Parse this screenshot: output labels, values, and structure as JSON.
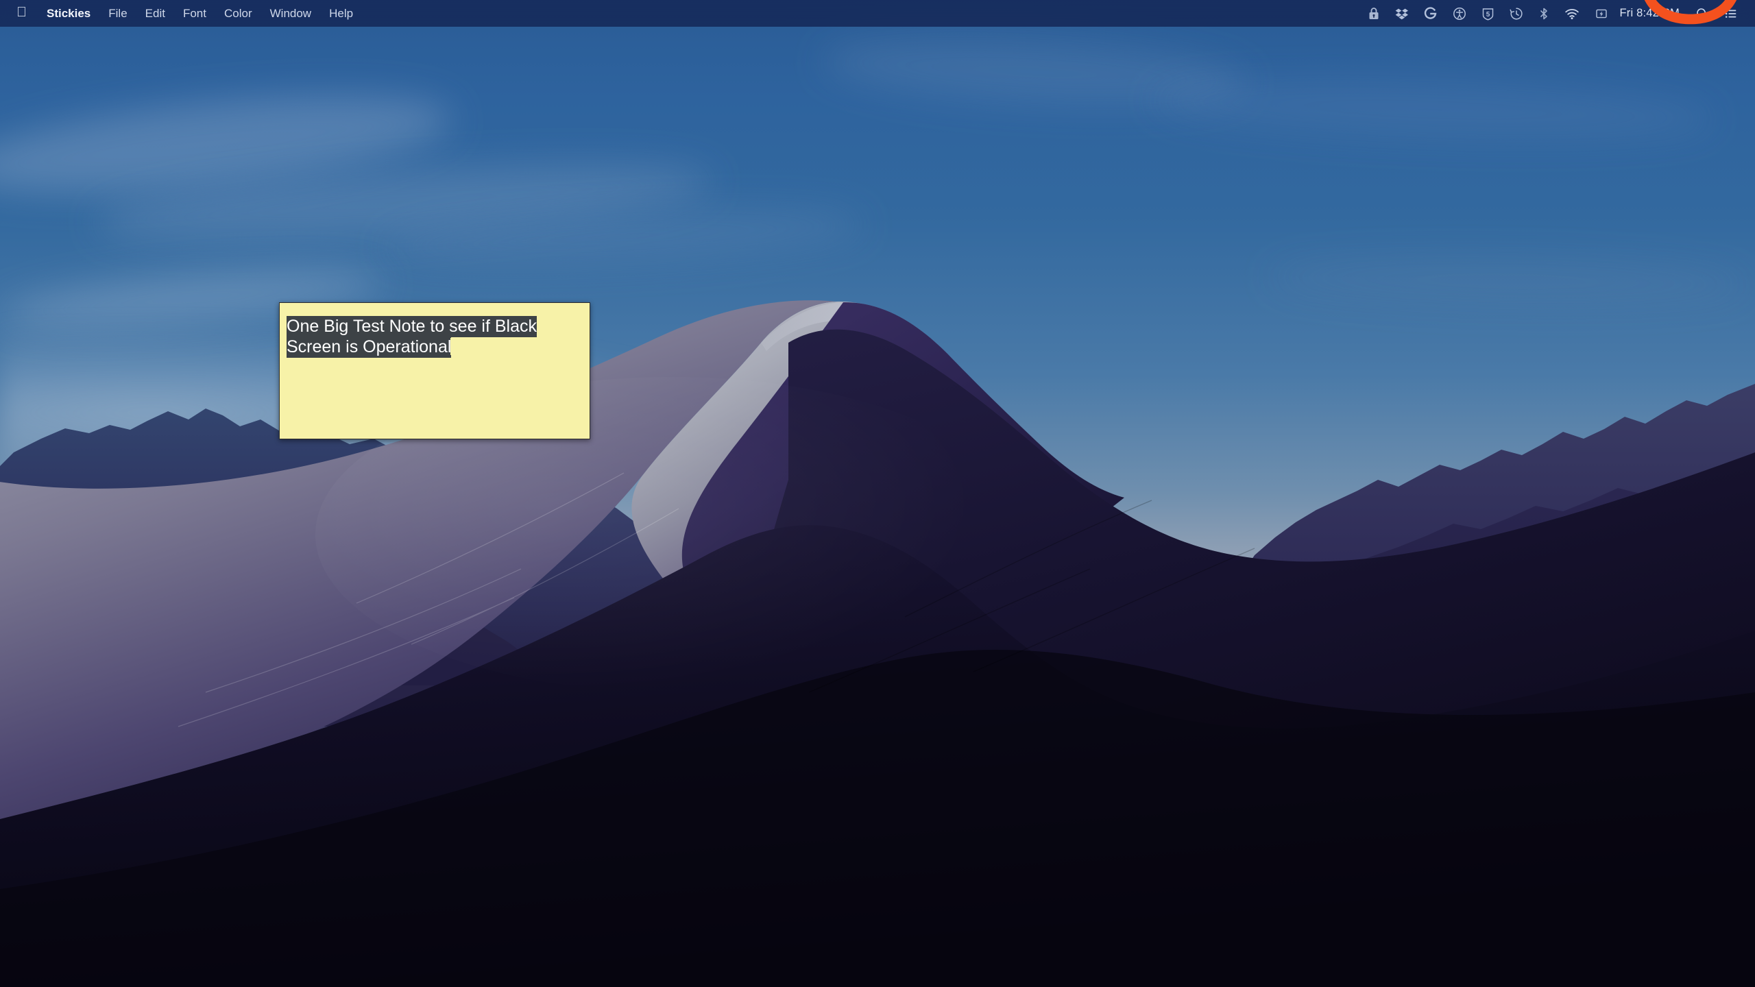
{
  "menubar": {
    "apple_logo": "apple-logo",
    "app_name": "Stickies",
    "menus": [
      {
        "label": "File"
      },
      {
        "label": "Edit"
      },
      {
        "label": "Font"
      },
      {
        "label": "Color"
      },
      {
        "label": "Window"
      },
      {
        "label": "Help"
      }
    ],
    "status_icons": [
      {
        "name": "lock-icon",
        "title": "Lock"
      },
      {
        "name": "dropbox-icon",
        "title": "Dropbox"
      },
      {
        "name": "logitech-g-icon",
        "title": "Logitech G"
      },
      {
        "name": "accessibility-icon",
        "title": "Accessibility"
      },
      {
        "name": "shield-5-icon",
        "title": "5"
      },
      {
        "name": "time-machine-icon",
        "title": "Time Machine"
      },
      {
        "name": "bluetooth-icon",
        "title": "Bluetooth"
      },
      {
        "name": "wifi-icon",
        "title": "Wi-Fi"
      },
      {
        "name": "battery-charging-icon",
        "title": "Battery"
      }
    ],
    "clock": "Fri 8:42 PM",
    "search_icon": "search-icon",
    "control-center_icon": "control-center-icon",
    "orange_overlay": "orange-arc-overlay"
  },
  "sticky_note": {
    "text_selected": "One Big Test Note to see if Black\nScreen is Operational",
    "line1": "One Big Test Note to see if Black",
    "line2": "Screen is Operational",
    "paper_color": "#f7f2a8",
    "selection_color": "#3d4246",
    "selection_text_color": "#ffffff",
    "border_color": "#2c2c2c"
  },
  "desktop": {
    "wallpaper_name": "Mojave Night",
    "sky_color": "#2e639e",
    "sand_light_color": "#9aa3b3",
    "sand_dark_color": "#241f45",
    "mountain_color": "#2a2d55"
  }
}
